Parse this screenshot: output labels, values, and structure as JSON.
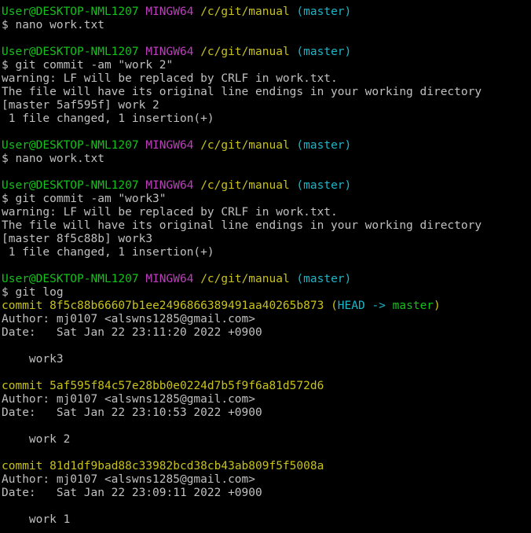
{
  "prompt": {
    "user": "User@DESKTOP-NML1207",
    "host": "MINGW64",
    "path": "/c/git/manual",
    "branch": "(master)"
  },
  "blocks": [
    {
      "command": "$ nano work.txt",
      "output": []
    },
    {
      "command": "$ git commit -am \"work 2\"",
      "output": [
        "warning: LF will be replaced by CRLF in work.txt.",
        "The file will have its original line endings in your working directory",
        "[master 5af595f] work 2",
        " 1 file changed, 1 insertion(+)"
      ]
    },
    {
      "command": "$ nano work.txt",
      "output": []
    },
    {
      "command": "$ git commit -am \"work3\"",
      "output": [
        "warning: LF will be replaced by CRLF in work.txt.",
        "The file will have its original line endings in your working directory",
        "[master 8f5c88b] work3",
        " 1 file changed, 1 insertion(+)"
      ]
    },
    {
      "command": "$ git log",
      "output": []
    }
  ],
  "log": [
    {
      "commit_label": "commit",
      "hash": "8f5c88b66607b1ee2496866389491aa40265b873",
      "decoration": {
        "head": "HEAD",
        "arrow": "->",
        "branch": "master"
      },
      "author": "Author: mj0107 <alswns1285@gmail.com>",
      "date": "Date:   Sat Jan 22 23:11:20 2022 +0900",
      "message": "    work3"
    },
    {
      "commit_label": "commit",
      "hash": "5af595f84c57e28bb0e0224d7b5f9f6a81d572d6",
      "author": "Author: mj0107 <alswns1285@gmail.com>",
      "date": "Date:   Sat Jan 22 23:10:53 2022 +0900",
      "message": "    work 2"
    },
    {
      "commit_label": "commit",
      "hash": "81d1df9bad88c33982bcd38cb43ab809f5f5008a",
      "author": "Author: mj0107 <alswns1285@gmail.com>",
      "date": "Date:   Sat Jan 22 23:09:11 2022 +0900",
      "message": "    work 1"
    }
  ],
  "colors": {
    "background": "#000000",
    "text": "#c0c0c0",
    "user": "#13c21a",
    "host": "#bc3fbc",
    "path": "#c8c21b",
    "branch": "#1ab7c8"
  }
}
